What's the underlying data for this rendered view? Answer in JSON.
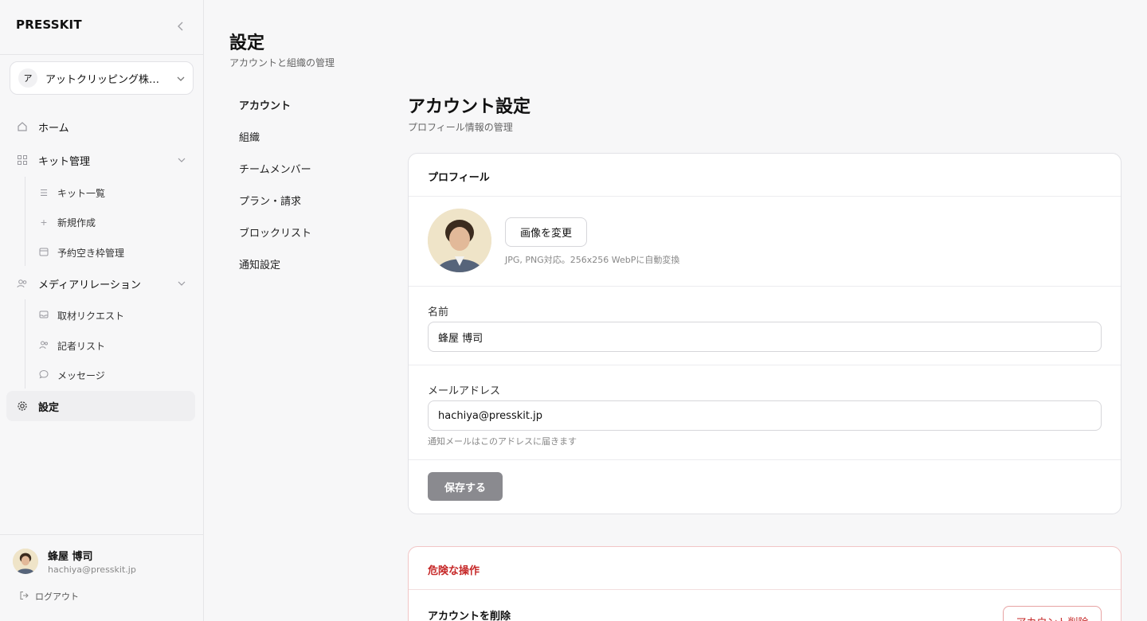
{
  "app": {
    "brand": "PRESSKIT"
  },
  "org": {
    "initial": "ア",
    "name": "アットクリッピング株式会社"
  },
  "sidebar": {
    "items": [
      {
        "label": "ホーム",
        "icon": "home-icon"
      },
      {
        "label": "キット管理",
        "icon": "grid-icon",
        "children": [
          {
            "label": "キット一覧",
            "icon": "list-icon"
          },
          {
            "label": "新規作成",
            "icon": "plus-icon"
          },
          {
            "label": "予約空き枠管理",
            "icon": "calendar-icon"
          }
        ]
      },
      {
        "label": "メディアリレーション",
        "icon": "users-icon",
        "children": [
          {
            "label": "取材リクエスト",
            "icon": "inbox-icon"
          },
          {
            "label": "記者リスト",
            "icon": "people-icon"
          },
          {
            "label": "メッセージ",
            "icon": "chat-icon"
          }
        ]
      },
      {
        "label": "設定",
        "icon": "gear-icon",
        "active": true
      }
    ]
  },
  "user": {
    "name": "蜂屋 博司",
    "email": "hachiya@presskit.jp",
    "logout": "ログアウト"
  },
  "page": {
    "title": "設定",
    "subtitle": "アカウントと組織の管理"
  },
  "settings_nav": [
    "アカウント",
    "組織",
    "チームメンバー",
    "プラン・請求",
    "ブロックリスト",
    "通知設定"
  ],
  "account": {
    "title": "アカウント設定",
    "subtitle": "プロフィール情報の管理",
    "profile_title": "プロフィール",
    "change_image": "画像を変更",
    "image_hint": "JPG, PNG対応。256x256 WebPに自動変換",
    "name_label": "名前",
    "name_value": "蜂屋 博司",
    "email_label": "メールアドレス",
    "email_value": "hachiya@presskit.jp",
    "email_hint": "通知メールはこのアドレスに届きます",
    "save": "保存する"
  },
  "danger": {
    "title": "危険な操作",
    "delete_label": "アカウントを削除",
    "delete_button": "アカウント削除"
  }
}
